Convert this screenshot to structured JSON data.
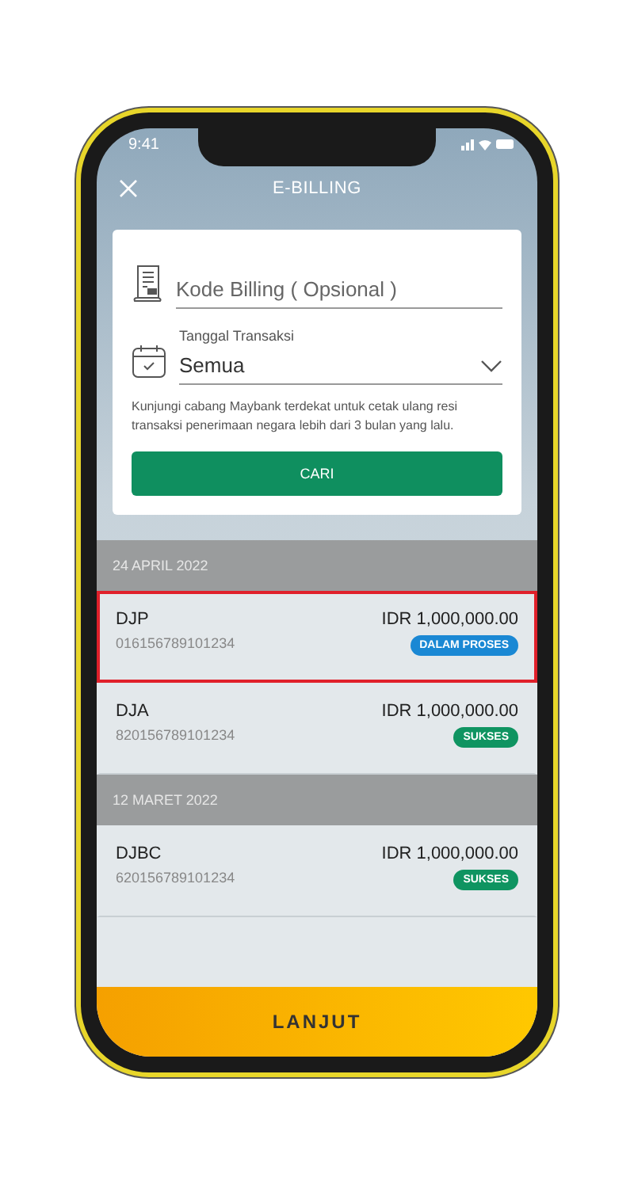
{
  "status_bar": {
    "time": "9:41"
  },
  "header": {
    "title": "E-BILLING"
  },
  "search_form": {
    "billing_code": {
      "placeholder": "Kode Billing ( Opsional )"
    },
    "date_field": {
      "label": "Tanggal Transaksi",
      "value": "Semua"
    },
    "note": "Kunjungi cabang Maybank terdekat untuk cetak ulang resi transaksi penerimaan negara lebih dari 3 bulan yang lalu.",
    "search_button": "CARI"
  },
  "groups": [
    {
      "date": "24 APRIL 2022",
      "items": [
        {
          "name": "DJP",
          "number": "016156789101234",
          "amount": "IDR 1,000,000.00",
          "status": "DALAM PROSES",
          "color": "#1a88d4",
          "selected": true
        },
        {
          "name": "DJA",
          "number": "820156789101234",
          "amount": "IDR 1,000,000.00",
          "status": "SUKSES",
          "color": "#0f9461",
          "selected": false
        }
      ]
    },
    {
      "date": "12 MARET 2022",
      "items": [
        {
          "name": "DJBC",
          "number": "620156789101234",
          "amount": "IDR 1,000,000.00",
          "status": "SUKSES",
          "color": "#0f9461",
          "selected": false
        }
      ]
    }
  ],
  "footer_button": "LANJUT"
}
